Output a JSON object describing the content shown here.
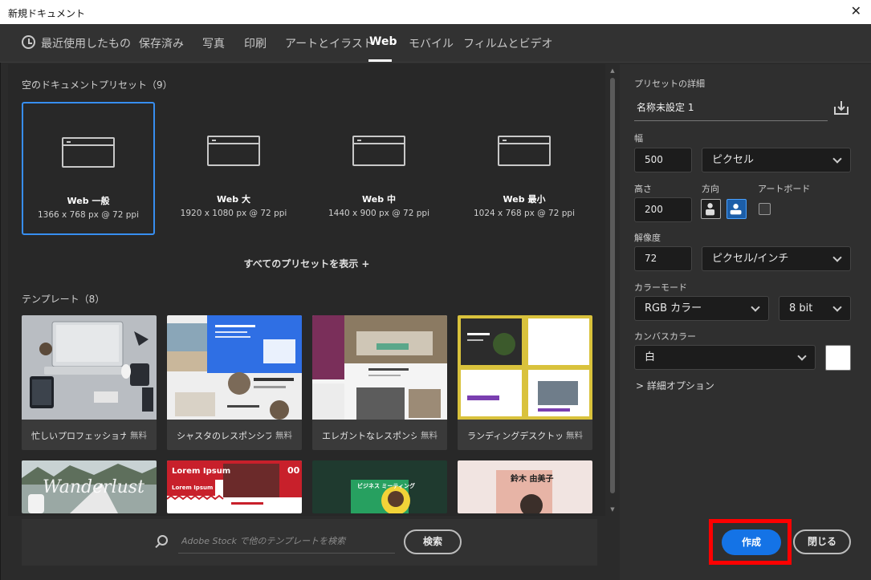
{
  "window": {
    "title": "新規ドキュメント",
    "close_glyph": "✕"
  },
  "tabs": [
    {
      "label": "最近使用したもの",
      "icon": "clock-icon"
    },
    {
      "label": "保存済み"
    },
    {
      "label": "写真"
    },
    {
      "label": "印刷"
    },
    {
      "label": "アートとイラスト"
    },
    {
      "label": "Web",
      "active": true
    },
    {
      "label": "モバイル"
    },
    {
      "label": "フィルムとビデオ"
    }
  ],
  "presets_section": {
    "heading": "空のドキュメントプリセット（9）",
    "items": [
      {
        "name": "Web 一般",
        "dims": "1366 x 768 px @ 72 ppi",
        "selected": true
      },
      {
        "name": "Web 大",
        "dims": "1920 x 1080 px @ 72 ppi"
      },
      {
        "name": "Web 中",
        "dims": "1440 x 900 px @ 72 ppi"
      },
      {
        "name": "Web 最小",
        "dims": "1024 x 768 px @ 72 ppi"
      }
    ],
    "show_all": "すべてのプリセットを表示 +"
  },
  "templates_section": {
    "heading": "テンプレート（8）",
    "items": [
      {
        "name": "忙しいプロフェッショナ...",
        "badge": "無料"
      },
      {
        "name": "シャスタのレスポンシブ...",
        "badge": "無料"
      },
      {
        "name": "エレガントなレスポンシ...",
        "badge": "無料"
      },
      {
        "name": "ランディングデスクトッ...",
        "badge": "無料"
      }
    ],
    "row2_text": {
      "wanderlust": "Wanderlust",
      "lorem": "Lorem Ipsum",
      "lorem_sub": "Lorem Ipsum",
      "num": "00",
      "biz": "ビジネス ミーティング",
      "book_title": "鈴木 由美子"
    }
  },
  "search": {
    "placeholder": "Adobe Stock で他のテンプレートを検索",
    "button": "検索"
  },
  "details": {
    "heading": "プリセットの詳細",
    "preset_name": "名称未設定 1",
    "width_label": "幅",
    "width_value": "500",
    "unit": "ピクセル",
    "height_label": "高さ",
    "height_value": "200",
    "orientation_label": "方向",
    "artboard_label": "アートボード",
    "resolution_label": "解像度",
    "resolution_value": "72",
    "resolution_unit": "ピクセル/インチ",
    "color_mode_label": "カラーモード",
    "color_mode": "RGB カラー",
    "bit_depth": "8 bit",
    "canvas_color_label": "カンバスカラー",
    "canvas_color": "白",
    "advanced": "詳細オプション"
  },
  "actions": {
    "create": "作成",
    "close": "閉じる"
  },
  "colors": {
    "accent": "#1473e6",
    "selection": "#378ef0",
    "highlight": "#ff0000"
  }
}
